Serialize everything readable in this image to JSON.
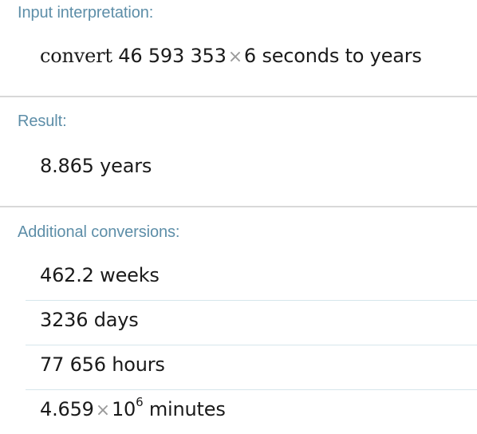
{
  "input_pod": {
    "title": "Input interpretation:",
    "query_word": "convert",
    "query_number": "46 593 353",
    "times_symbol": "×",
    "query_multiplier": "6",
    "query_rest": "seconds to years"
  },
  "result_pod": {
    "title": "Result:",
    "value": "8.865 years"
  },
  "conversions_pod": {
    "title": "Additional conversions:",
    "rows": [
      {
        "value": "462.2 weeks"
      },
      {
        "value": "3236 days"
      },
      {
        "value": "77 656 hours"
      },
      {
        "mantissa": "4.659",
        "times_symbol": "×",
        "base": "10",
        "exponent": "6",
        "unit": "minutes"
      }
    ]
  },
  "colors": {
    "pod_title": "#5d8ea8",
    "value_text": "#1a1a1a",
    "pod_divider": "#d8d8d8",
    "row_divider": "#d6e6ec"
  }
}
